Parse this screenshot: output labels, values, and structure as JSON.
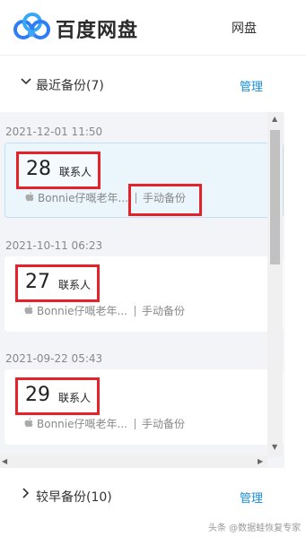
{
  "header": {
    "brand": "百度网盘",
    "nav_item": "网盘"
  },
  "recent_section": {
    "title": "最近备份(7)",
    "manage": "管理"
  },
  "backups": [
    {
      "date": "2021-12-01 11:50",
      "count": "28",
      "count_label": "联系人",
      "device": "Bonnie仔嘅老年...",
      "mode": "手动备份",
      "selected": true
    },
    {
      "date": "2021-10-11 06:23",
      "count": "27",
      "count_label": "联系人",
      "device": "Bonnie仔嘅老年...",
      "mode": "手动备份",
      "selected": false
    },
    {
      "date": "2021-09-22 05:43",
      "count": "29",
      "count_label": "联系人",
      "device": "Bonnie仔嘅老年...",
      "mode": "手动备份",
      "selected": false
    }
  ],
  "earlier_section": {
    "title": "较早备份(10)",
    "manage": "管理"
  },
  "watermark": "头条 @数据蛙恢复专家",
  "colors": {
    "accent": "#1a8fd8",
    "highlight": "#e5222a",
    "selected_bg": "#eaf5fc"
  }
}
